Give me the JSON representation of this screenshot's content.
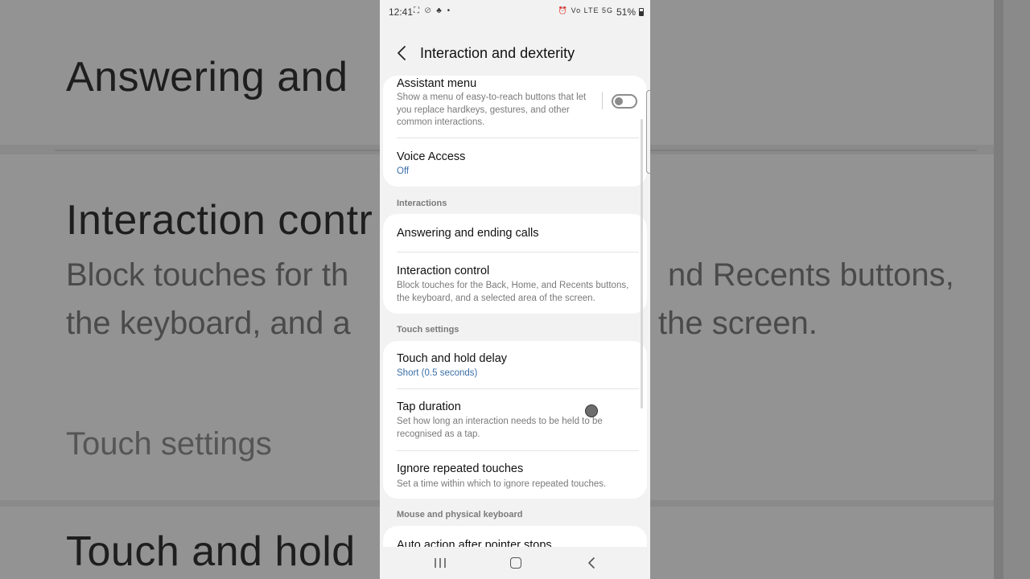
{
  "background": {
    "line1": "Answering and",
    "line2": "Interaction contr",
    "line3a": "Block touches for th",
    "line3b": "nd Recents buttons,",
    "line4a": "the keyboard, and a",
    "line4b": "the screen.",
    "line5": "Touch settings",
    "line6": "Touch and hold"
  },
  "status_bar": {
    "time": "12:41",
    "left_icons": "⛶ ⊘ ♣ •",
    "right_icons": "⏰ Vo LTE 5G",
    "battery": "51%"
  },
  "app_bar": {
    "title": "Interaction and dexterity"
  },
  "group1": {
    "assistant_menu": {
      "title": "Assistant menu",
      "summary": "Show a menu of easy-to-reach buttons that let you replace hardkeys, gestures, and other common interactions.",
      "enabled": false
    },
    "voice_access": {
      "title": "Voice Access",
      "value": "Off"
    }
  },
  "section_interactions": "Interactions",
  "group2": {
    "answering_calls": {
      "title": "Answering and ending calls"
    },
    "interaction_control": {
      "title": "Interaction control",
      "summary": "Block touches for the Back, Home, and Recents buttons, the keyboard, and a selected area of the screen."
    }
  },
  "section_touch": "Touch settings",
  "group3": {
    "touch_hold_delay": {
      "title": "Touch and hold delay",
      "value": "Short (0.5 seconds)"
    },
    "tap_duration": {
      "title": "Tap duration",
      "summary": "Set how long an interaction needs to be held to be recognised as a tap."
    },
    "ignore_repeated": {
      "title": "Ignore repeated touches",
      "summary": "Set a time within which to ignore repeated touches."
    }
  },
  "section_mouse": "Mouse and physical keyboard",
  "group4": {
    "auto_action": {
      "title": "Auto action after pointer stops"
    }
  },
  "colors": {
    "accent_value": "#3a6ea8",
    "card_bg": "#ffffff",
    "screen_bg": "#f2f2f2"
  }
}
